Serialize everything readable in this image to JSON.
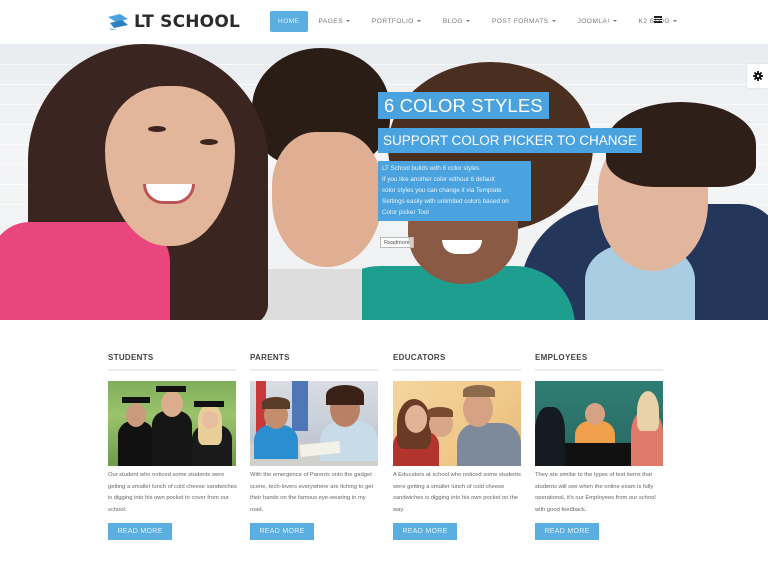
{
  "header": {
    "logo_text": "LT SCHOOL",
    "nav": [
      {
        "label": "HOME",
        "active": true,
        "caret": false
      },
      {
        "label": "PAGES",
        "caret": true
      },
      {
        "label": "PORTFOLIO",
        "caret": true
      },
      {
        "label": "BLOG",
        "caret": true
      },
      {
        "label": "POST FORMATS",
        "caret": true
      },
      {
        "label": "JOOMLA!",
        "caret": true
      },
      {
        "label": "K2 BLOG",
        "caret": true
      }
    ],
    "menu_icon": "hamburger-icon",
    "accent_color": "#5aaee0"
  },
  "hero": {
    "title": "6 COLOR STYLES",
    "subtitle": "SUPPORT COLOR PICKER TO CHANGE",
    "body_lines": [
      "LT School builds with 6 color styles",
      "If you like another color without 6 default",
      "color styles you can change it via Template",
      "Settings easily with unlimited colors based on",
      "Color picker Tool"
    ],
    "readmore_label": "Readmore",
    "caption_color": "#4aa3de",
    "settings_icon": "gear-icon"
  },
  "columns": [
    {
      "title": "STUDENTS",
      "text": "Our student who noticed some students were getting a smaller lunch of cold cheese sandwiches is digging into his own pocket to cover from our school.",
      "button": "READ MORE"
    },
    {
      "title": "PARENTS",
      "text": "With the emergence of Parents onto the gadget scene, tech-lovers everywhere are itching to get their hands on the famous eye-wearing in my road.",
      "button": "READ MORE"
    },
    {
      "title": "EDUCATORS",
      "text": "A Educators at school who noticed some students were getting a smaller lunch of cold cheese sandwiches is digging into his own pocket on the way.",
      "button": "READ MORE"
    },
    {
      "title": "EMPLOYEES",
      "text": "They are similar to the types of test items that students will see when the online exam is fully operational, it's our Employees from our school with good feedback.",
      "button": "READ MORE"
    }
  ]
}
